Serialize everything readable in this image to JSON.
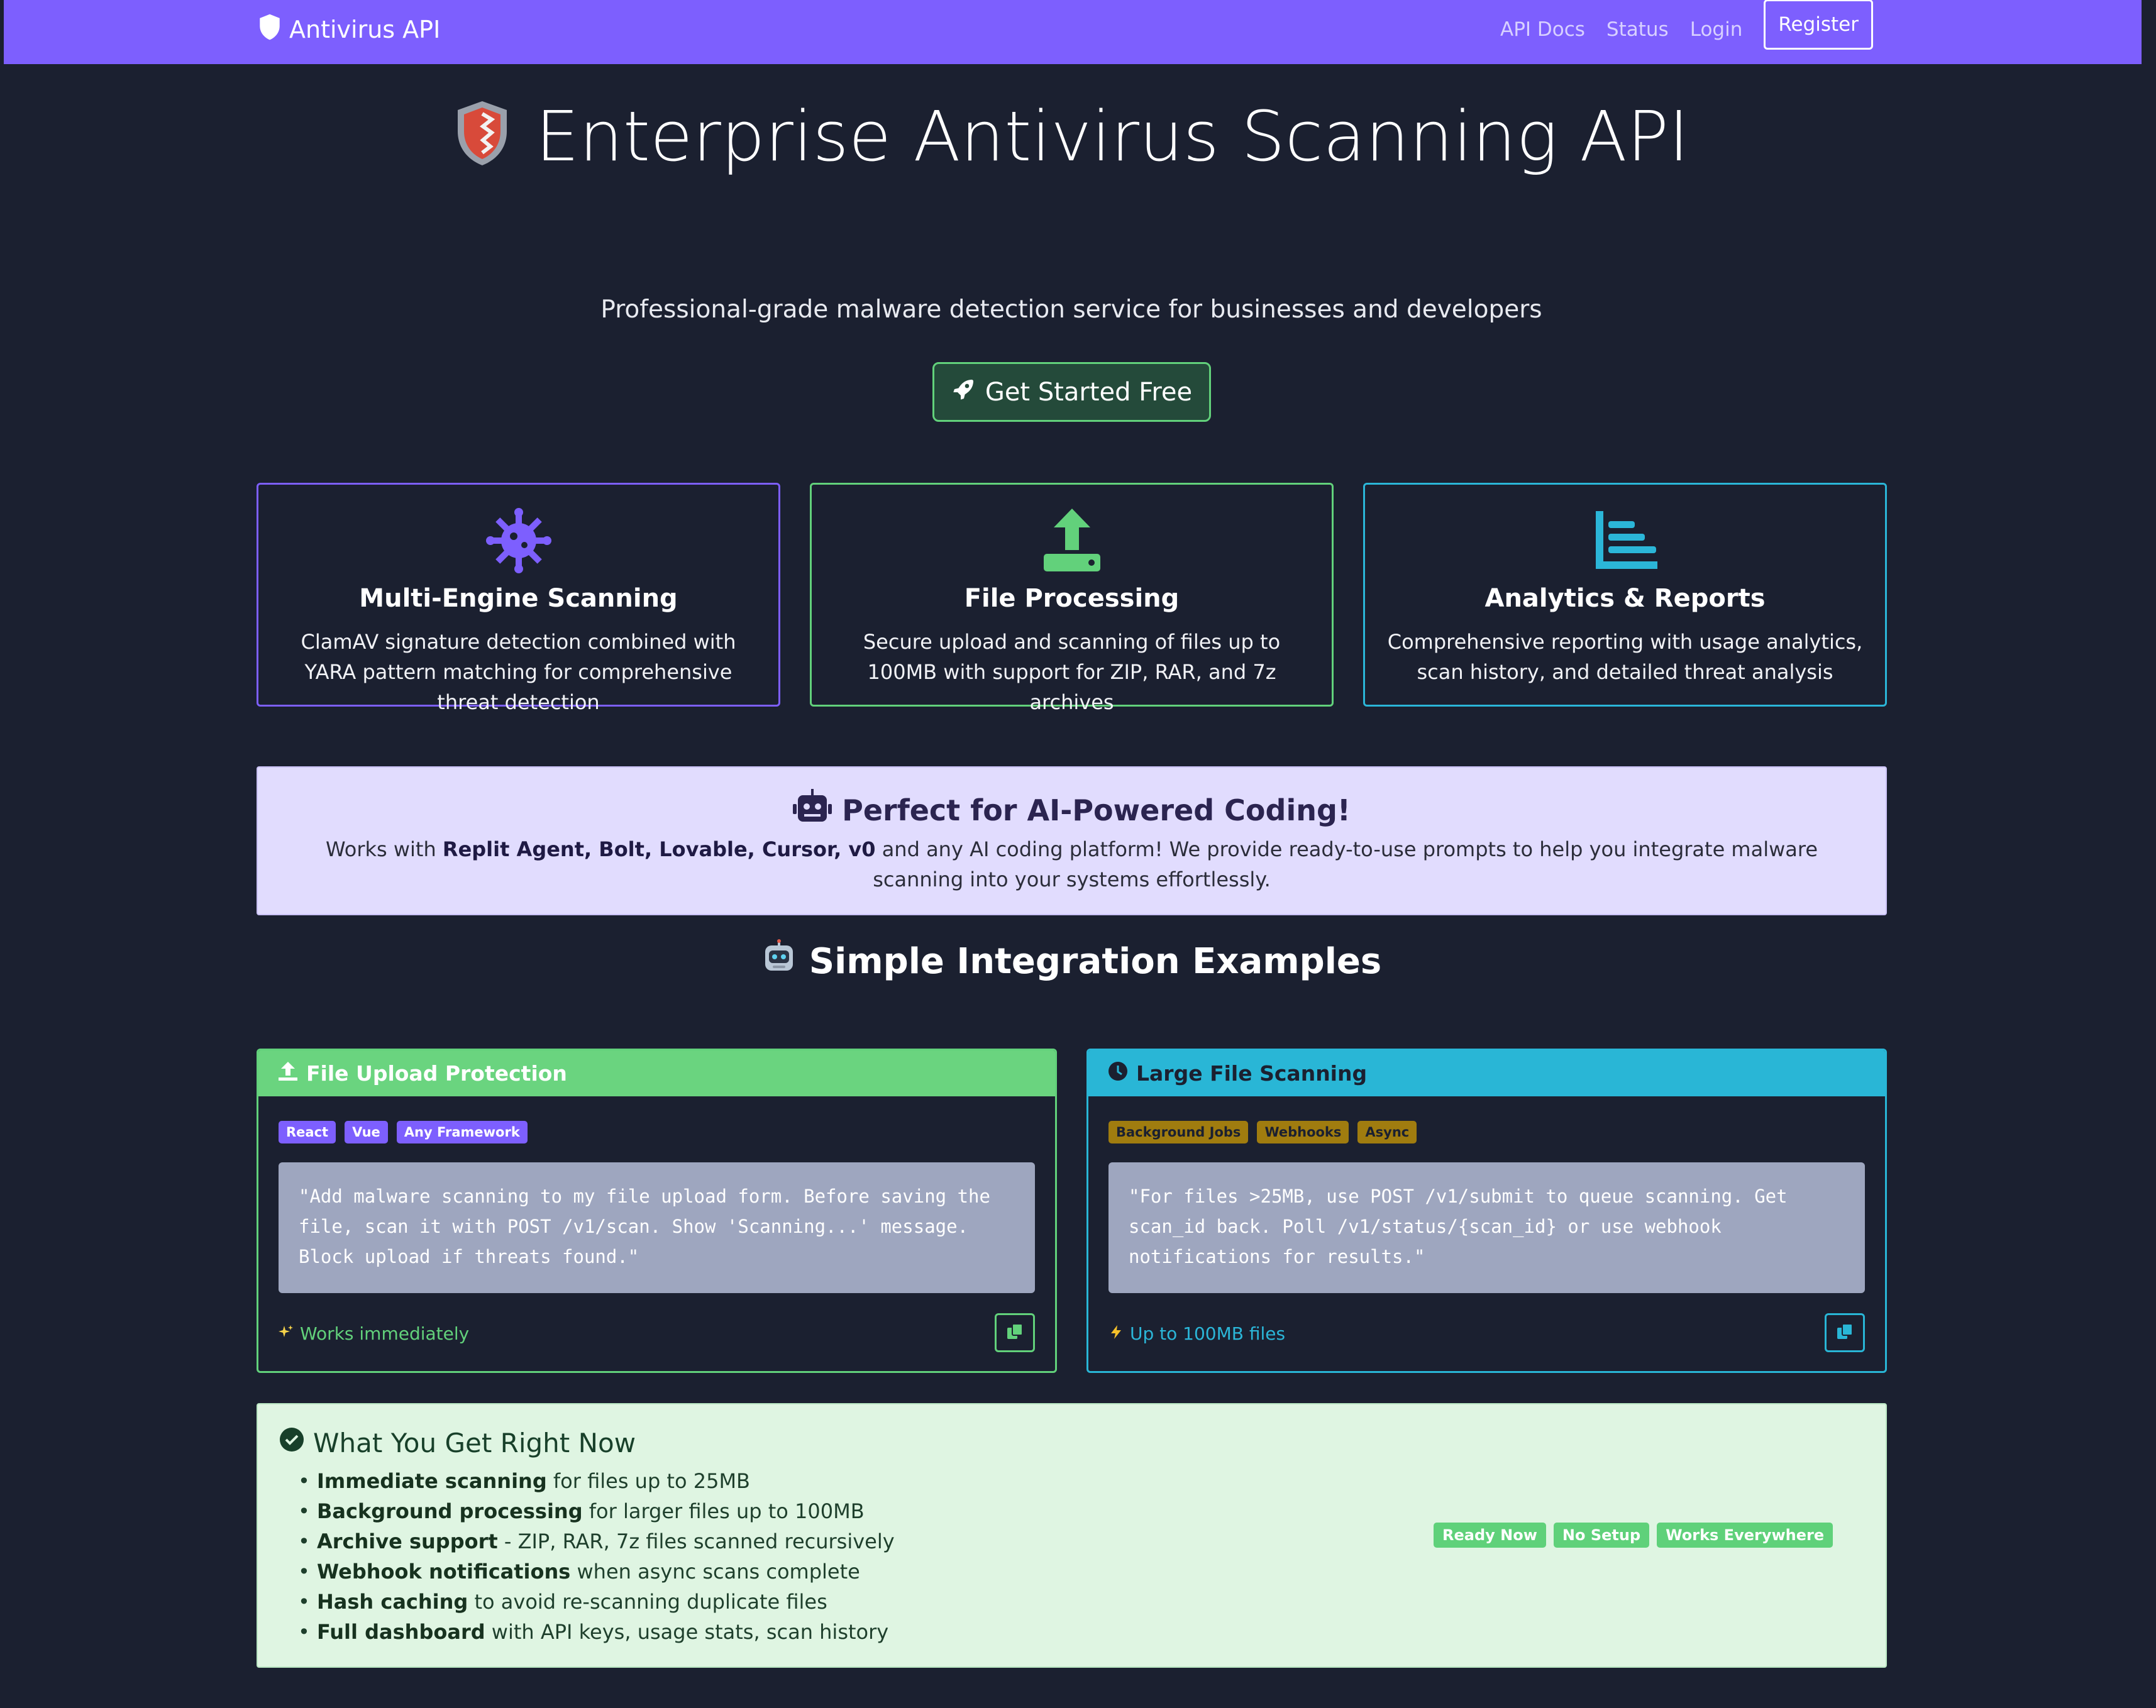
{
  "navbar": {
    "brand": "Antivirus API",
    "links": [
      "API Docs",
      "Status",
      "Login"
    ],
    "register_label": "Register"
  },
  "hero": {
    "title": "Enterprise Antivirus Scanning API",
    "subtitle": "Professional-grade malware detection service for businesses and developers",
    "cta_label": "Get Started Free"
  },
  "features": [
    {
      "icon": "virus-icon",
      "color": "#7d5ffe",
      "title": "Multi-Engine Scanning",
      "description": "ClamAV signature detection combined with YARA pattern matching for comprehensive threat detection"
    },
    {
      "icon": "upload-icon",
      "color": "#62d17b",
      "title": "File Processing",
      "description": "Secure upload and scanning of files up to 100MB with support for ZIP, RAR, and 7z archives"
    },
    {
      "icon": "chart-bar-icon",
      "color": "#2bb6d8",
      "title": "Analytics & Reports",
      "description": "Comprehensive reporting with usage analytics, scan history, and detailed threat analysis"
    }
  ],
  "ai_box": {
    "title": "Perfect for AI-Powered Coding!",
    "desc_prefix": "Works with ",
    "desc_bold": "Replit Agent, Bolt, Lovable, Cursor, v0",
    "desc_suffix": " and any AI coding platform! We provide ready-to-use prompts to help you integrate malware scanning into your systems effortlessly."
  },
  "examples": {
    "title": "Simple Integration Examples",
    "cards": [
      {
        "title": "File Upload Protection",
        "header_color": "#6ad47f",
        "tags": [
          "React",
          "Vue",
          "Any Framework"
        ],
        "tag_color": "#7d5ffe",
        "prompt": "\"Add malware scanning to my file upload form. Before saving the file, scan it with POST /v1/scan. Show 'Scanning...' message. Block upload if threats found.\"",
        "note": "Works immediately",
        "note_color": "#62d17b"
      },
      {
        "title": "Large File Scanning",
        "header_color": "#29b6d6",
        "tags": [
          "Background Jobs",
          "Webhooks",
          "Async"
        ],
        "tag_color": "#a07c0f",
        "prompt": "\"For files >25MB, use POST /v1/submit to queue scanning. Get scan_id back. Poll /v1/status/{scan_id} or use webhook notifications for results.\"",
        "note": "Up to 100MB files",
        "note_color": "#2bb6d8"
      }
    ]
  },
  "now_box": {
    "title": "What You Get Right Now",
    "items": [
      {
        "bold": "Immediate scanning",
        "rest": " for files up to 25MB"
      },
      {
        "bold": "Background processing",
        "rest": " for larger files up to 100MB"
      },
      {
        "bold": "Archive support",
        "rest": " - ZIP, RAR, 7z files scanned recursively"
      },
      {
        "bold": "Webhook notifications",
        "rest": " when async scans complete"
      },
      {
        "bold": "Hash caching",
        "rest": " to avoid re-scanning duplicate files"
      },
      {
        "bold": "Full dashboard",
        "rest": " with API keys, usage stats, scan history"
      }
    ],
    "badges": [
      "Ready Now",
      "No Setup",
      "Works Everywhere"
    ]
  }
}
